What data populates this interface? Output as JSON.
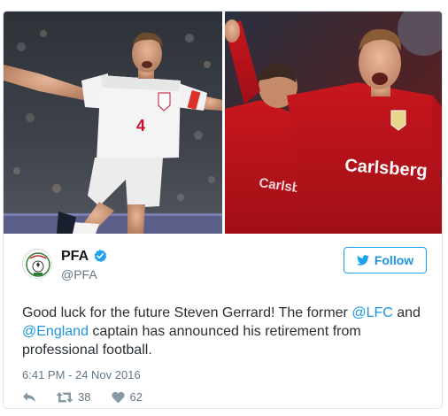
{
  "profile": {
    "name": "PFA",
    "handle": "@PFA"
  },
  "follow_button": {
    "label": "Follow"
  },
  "tweet": {
    "text_part1": "Good luck for the future Steven Gerrard! The former ",
    "mention1": "@LFC",
    "text_part2": " and ",
    "mention2": "@England",
    "text_part3": " captain has announced his retirement from professional football.",
    "timestamp": "6:41 PM - 24 Nov 2016"
  },
  "actions": {
    "retweet_count": "38",
    "like_count": "62"
  },
  "photo_text": {
    "england_shirt_number": "4",
    "liverpool_sponsor": "Carlsberg",
    "liverpool_sponsor_back": "Carlsb"
  },
  "colors": {
    "link": "#1b95e0",
    "verified": "#1da1f2",
    "text": "#292f33",
    "muted": "#657786"
  }
}
